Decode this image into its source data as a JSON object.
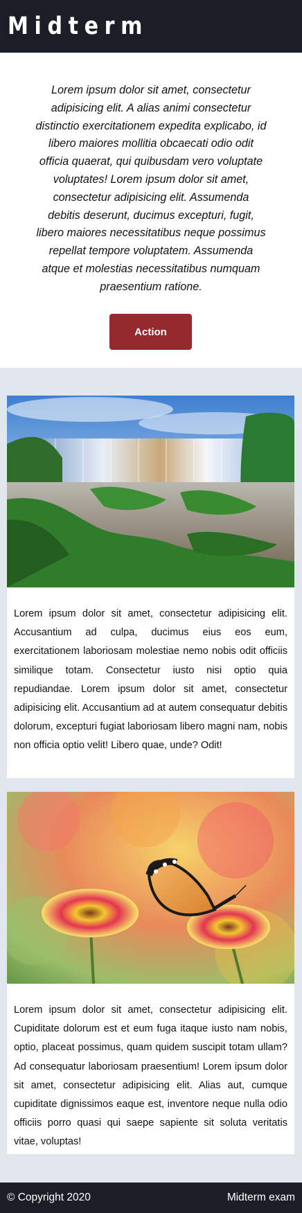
{
  "header": {
    "title": "Midterm"
  },
  "intro": {
    "text": "Lorem ipsum dolor sit amet, consectetur adipisicing elit. A alias animi consectetur distinctio exercitationem expedita explicabo, id libero maiores mollitia obcaecati odio odit officia quaerat, qui quibusdam vero voluptate voluptates! Lorem ipsum dolor sit amet, consectetur adipisicing elit. Assumenda debitis deserunt, ducimus excepturi, fugit, libero maiores necessitatibus neque possimus repellat tempore voluptatem. Assumenda atque et molestias necessitatibus numquam praesentium ratione.",
    "action_label": "Action"
  },
  "cards": [
    {
      "image": "waterfall-landscape",
      "text": "Lorem ipsum dolor sit amet, consectetur adipisicing elit. Accusantium ad culpa, ducimus eius eos eum, exercitationem laboriosam molestiae nemo nobis odit officiis similique totam. Consectetur iusto nisi optio quia repudiandae. Lorem ipsum dolor sit amet, consectetur adipisicing elit. Accusantium ad at autem consequatur debitis dolorum, excepturi fugiat laboriosam libero magni nam, nobis non officia optio velit! Libero quae, unde? Odit!"
    },
    {
      "image": "butterfly-on-flowers",
      "text": "Lorem ipsum dolor sit amet, consectetur adipisicing elit. Cupiditate dolorum est et eum fuga itaque iusto nam nobis, optio, placeat possimus, quam quidem suscipit totam ullam? Ad consequatur laboriosam praesentium! Lorem ipsum dolor sit amet, consectetur adipisicing elit. Alias aut, cumque cupiditate dignissimos eaque est, inventore neque nulla odio officiis porro quasi qui saepe sapiente sit soluta veritatis vitae, voluptas!"
    }
  ],
  "footer": {
    "copyright": "© Copyright 2020",
    "right_text": "Midterm exam"
  },
  "colors": {
    "header_bg": "#1b1e26",
    "page_bg": "#e2e7ee",
    "action_button": "#952a2e"
  }
}
